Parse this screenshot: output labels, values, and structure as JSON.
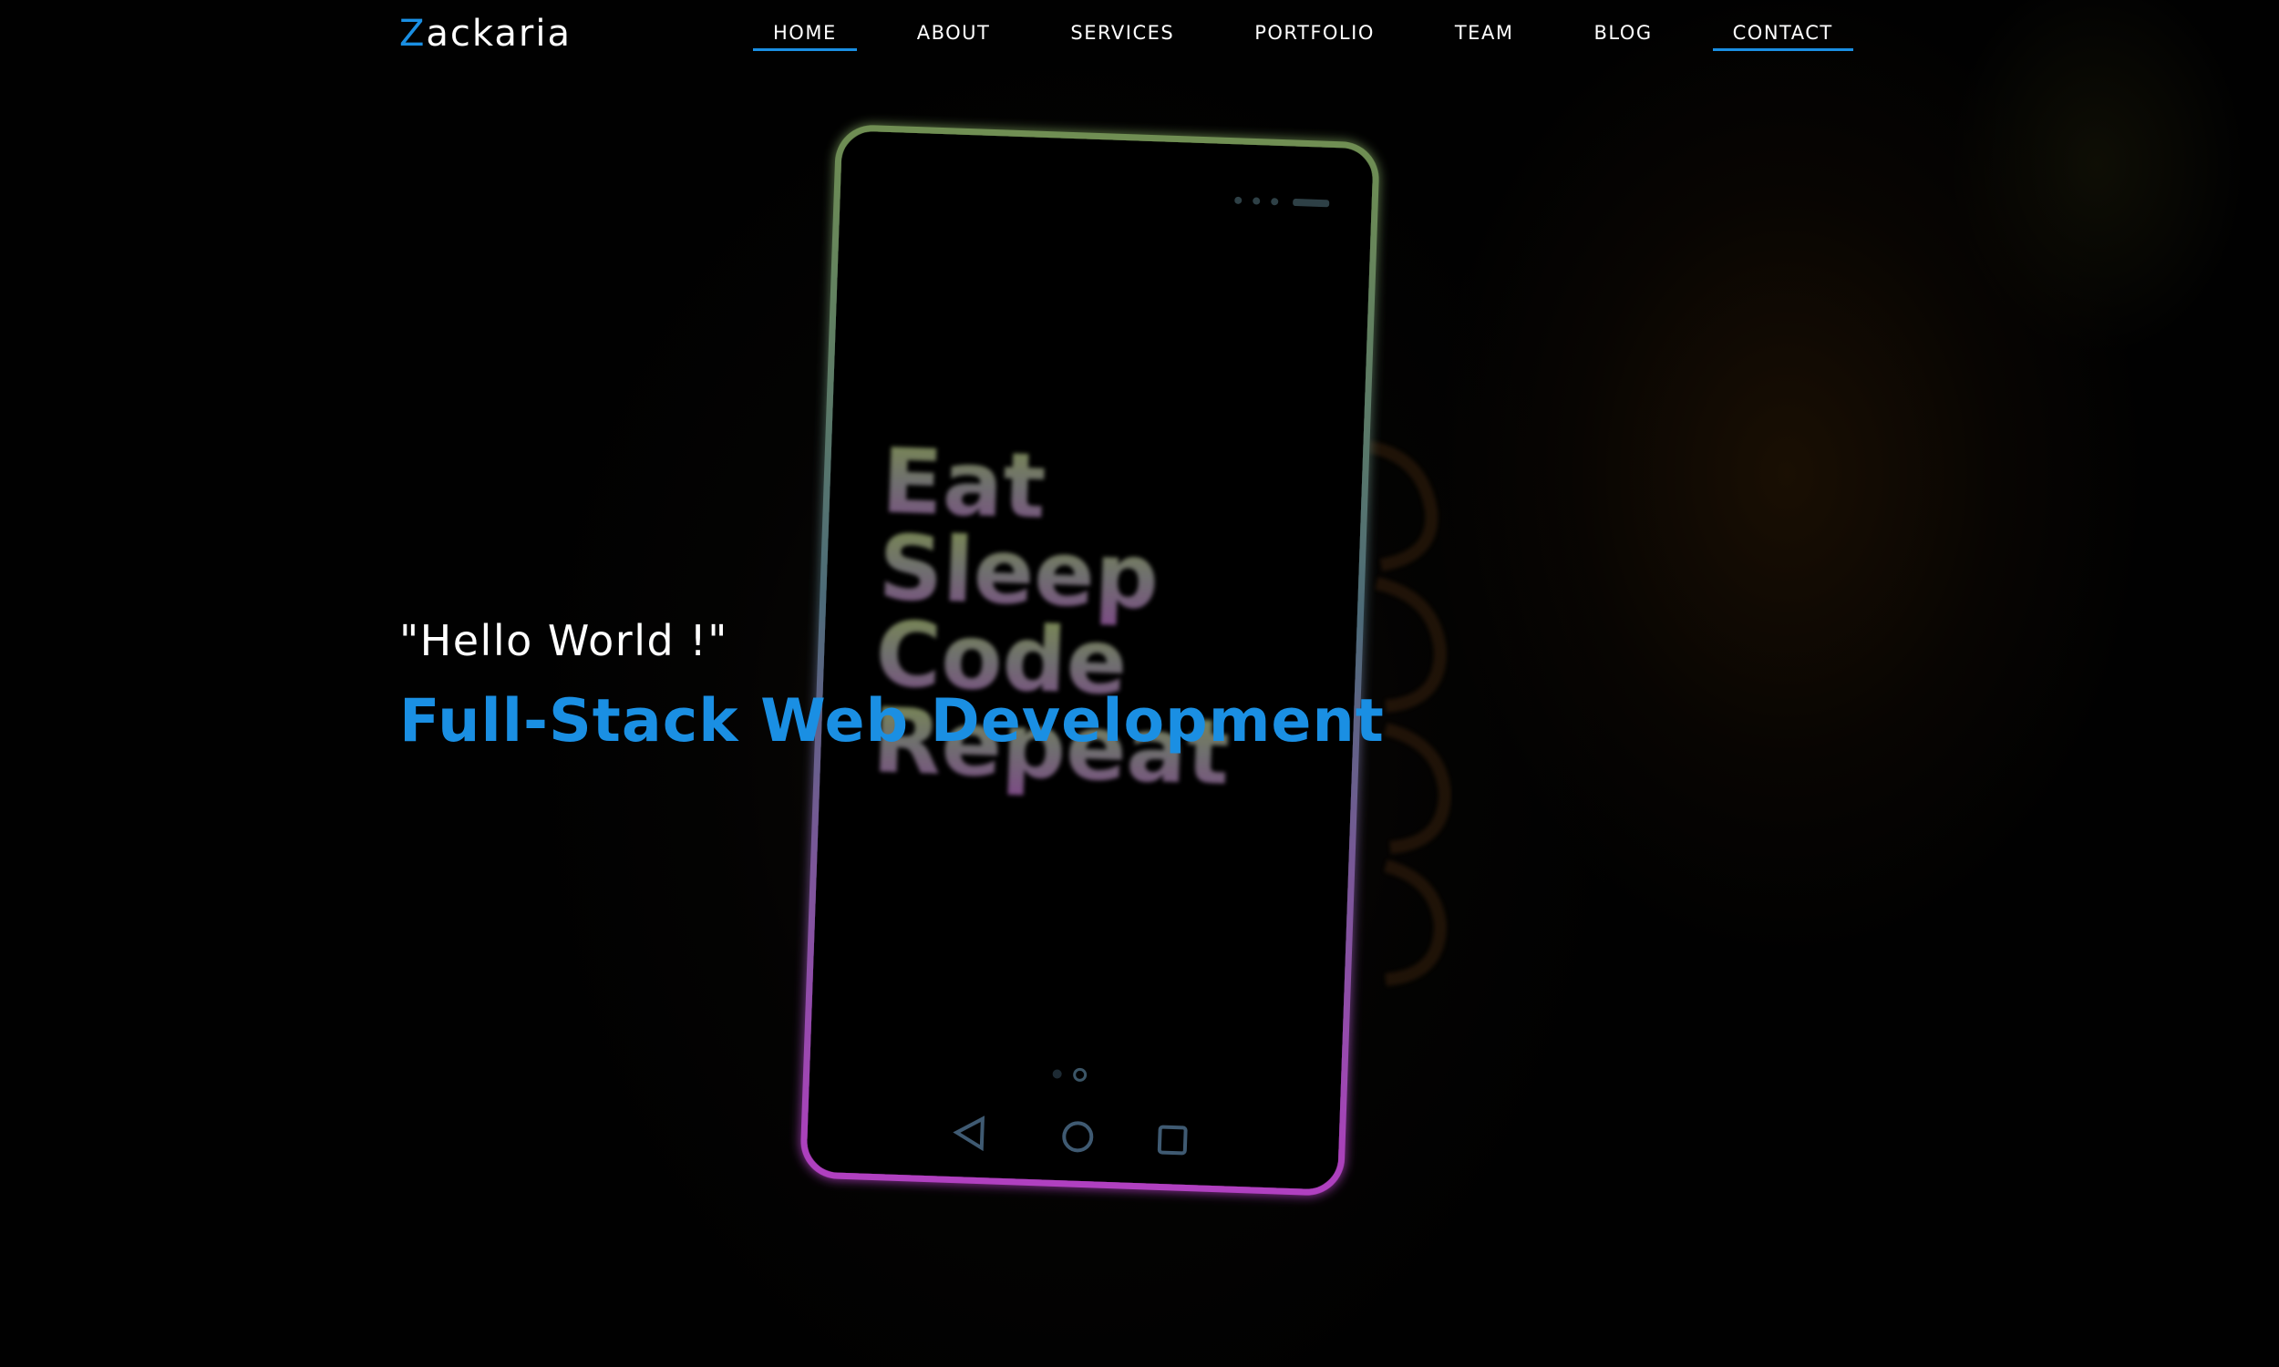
{
  "header": {
    "logo": {
      "initial": "Z",
      "rest": "ackaria"
    },
    "nav": [
      {
        "label": "HOME",
        "active": true
      },
      {
        "label": "ABOUT",
        "active": false
      },
      {
        "label": "SERVICES",
        "active": false
      },
      {
        "label": "PORTFOLIO",
        "active": false
      },
      {
        "label": "TEAM",
        "active": false
      },
      {
        "label": "BLOG",
        "active": false
      },
      {
        "label": "CONTACT",
        "active": false
      }
    ]
  },
  "hero": {
    "greeting": "\"Hello World !\"",
    "headline": "Full-Stack Web Development",
    "phone_screen_lines": [
      "Eat",
      "Sleep",
      "Code",
      "Repeat"
    ]
  },
  "colors": {
    "accent": "#1a8fe3",
    "text": "#ffffff",
    "background": "#030303"
  },
  "icons": [
    "back-triangle-icon",
    "home-circle-icon",
    "recent-square-icon"
  ]
}
